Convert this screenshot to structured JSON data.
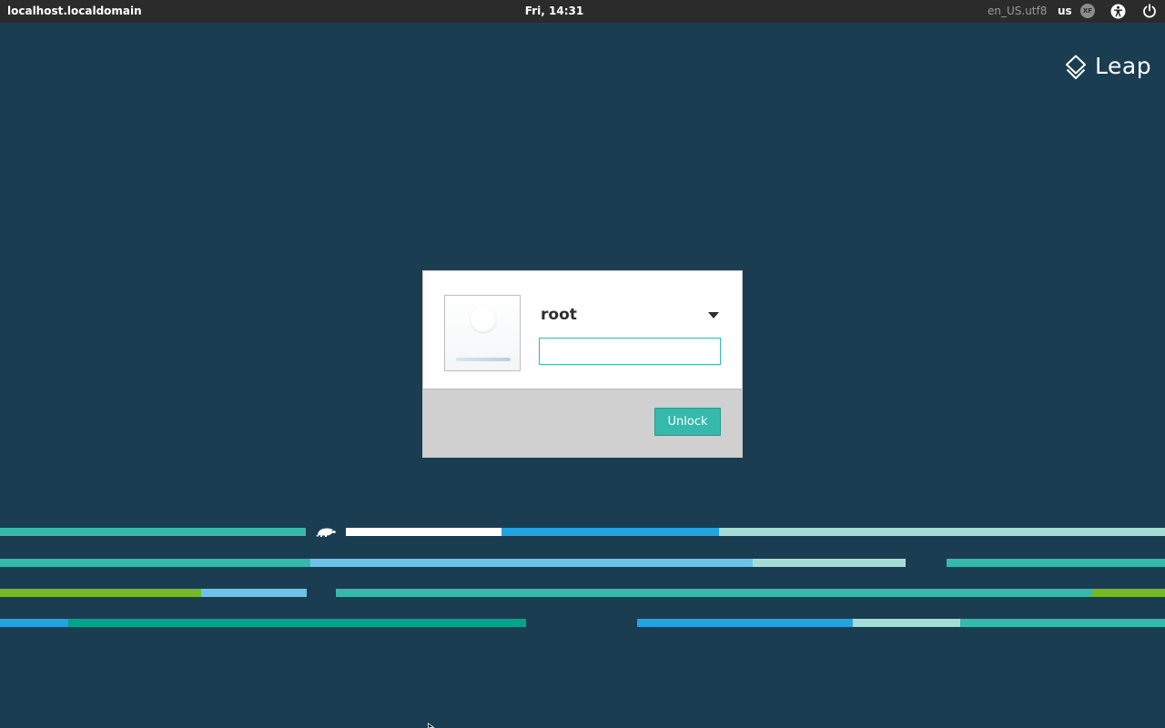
{
  "topbar": {
    "hostname": "localhost.localdomain",
    "clock": "Fri, 14:31",
    "locale": "en_US.utf8",
    "keyboard_layout": "us",
    "xf_badge": "XF",
    "icons": [
      "xf-icon",
      "accessibility-icon",
      "power-icon"
    ]
  },
  "brand": {
    "name": "Leap",
    "icon": "leap-diamond-icon",
    "color": "#ffffff"
  },
  "lock_dialog": {
    "username": "root",
    "avatar_icon": "user-avatar-icon",
    "user_menu_icon": "chevron-down-icon",
    "password_value": "",
    "password_placeholder": "",
    "unlock_label": "Unlock",
    "accent_color": "#35b9ab"
  },
  "theme": {
    "background": "#1b3d52",
    "teal": "#35b9ab",
    "blue": "#21a4df",
    "light_blue": "#6ec2ea",
    "pale_teal": "#a3ddd6",
    "green": "#73ba25",
    "dark_teal": "#00a489",
    "white": "#ffffff"
  }
}
